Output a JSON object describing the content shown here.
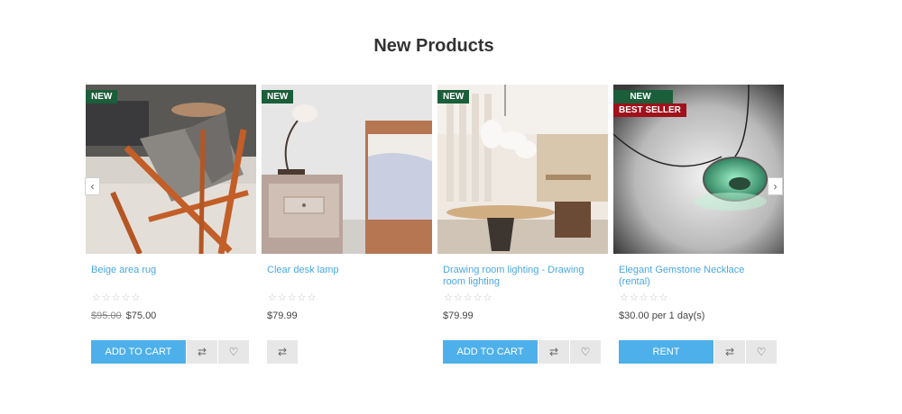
{
  "section": {
    "title": "New Products"
  },
  "badges": {
    "new": "NEW",
    "best_seller": "BEST SELLER"
  },
  "carousel": {
    "prev_icon": "chevron-left-icon",
    "next_icon": "chevron-right-icon",
    "prev_glyph": "‹",
    "next_glyph": "›"
  },
  "rating_glyphs": "☆☆☆☆☆",
  "icons": {
    "compare_glyph": "⇄",
    "wishlist_glyph": "♡"
  },
  "products": [
    {
      "name": "Beige area rug",
      "rating": 0,
      "old_price": "$95.00",
      "price": "$75.00",
      "action_label": "ADD TO CART",
      "badges": [
        "NEW"
      ]
    },
    {
      "name": "Clear desk lamp",
      "rating": 0,
      "price": "$79.99",
      "badges": [
        "NEW"
      ]
    },
    {
      "name": "Drawing room lighting - Drawing room lighting",
      "rating": 0,
      "price": "$79.99",
      "action_label": "ADD TO CART",
      "badges": [
        "NEW"
      ]
    },
    {
      "name": "Elegant Gemstone Necklace (rental)",
      "rating": 0,
      "price": "$30.00 per 1 day(s)",
      "action_label": "RENT",
      "badges": [
        "NEW",
        "BEST SELLER"
      ]
    }
  ],
  "colors": {
    "accent": "#4eb0ea",
    "link": "#4aa7e0",
    "badge_new": "#1b5e3a",
    "badge_best": "#a0111b"
  }
}
